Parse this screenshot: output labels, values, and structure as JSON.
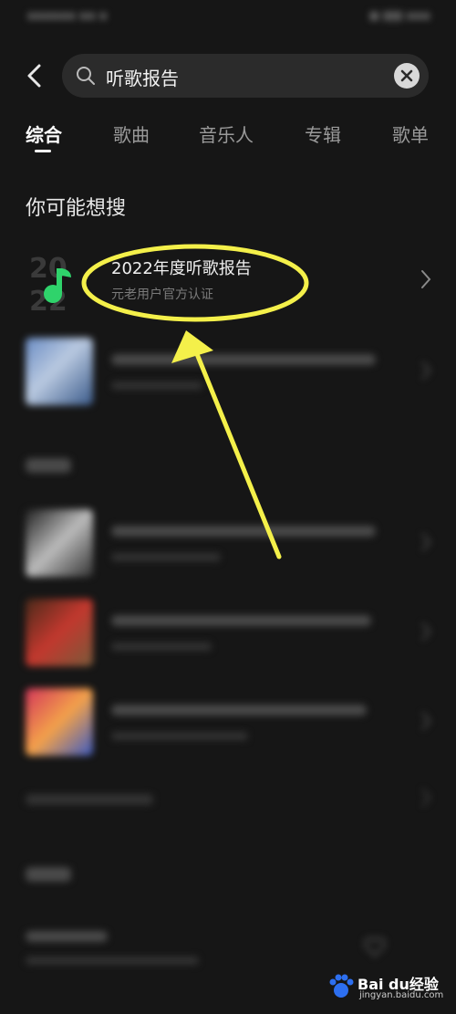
{
  "search": {
    "query": "听歌报告"
  },
  "tabs": [
    {
      "label": "综合"
    },
    {
      "label": "歌曲"
    },
    {
      "label": "音乐人"
    },
    {
      "label": "专辑"
    },
    {
      "label": "歌单"
    }
  ],
  "suggest": {
    "title": "你可能想搜",
    "top_result": {
      "title": "2022年度听歌报告",
      "subtitle": "元老用户官方认证",
      "logo_text": "2022"
    }
  },
  "watermark": {
    "main": "Bai du经验",
    "sub": "jingyan.baidu.com"
  },
  "colors": {
    "accent_green": "#2fd36b",
    "annotation_yellow": "#f4f04a",
    "background": "#161616"
  }
}
